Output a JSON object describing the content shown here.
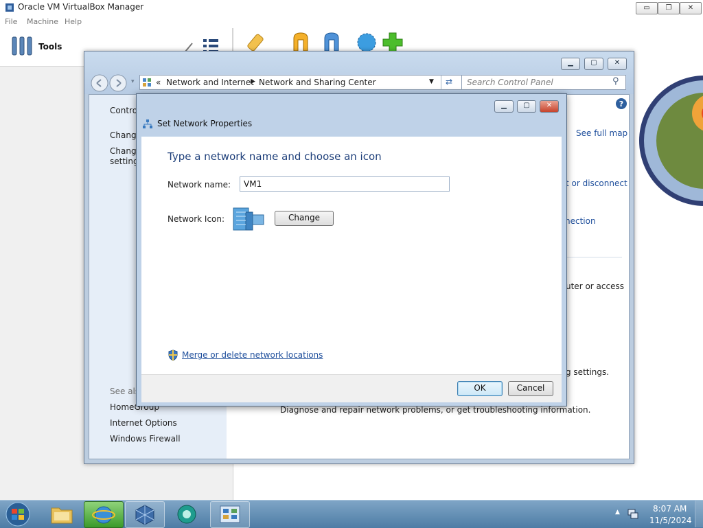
{
  "vbox": {
    "title": "Oracle VM VirtualBox Manager",
    "menu": [
      "File",
      "Machine",
      "Help"
    ],
    "tools_label": "Tools",
    "controls": [
      "▭",
      "❐",
      "✕"
    ]
  },
  "control_panel": {
    "breadcrumb": {
      "prefix": "«",
      "items": [
        "Network and Internet",
        "Network and Sharing Center"
      ]
    },
    "search_placeholder": "Search Control Panel",
    "left_items": [
      "Control",
      "Change",
      "Change",
      "settings"
    ],
    "see_also_label": "See also",
    "see_also_items": [
      "HomeGroup",
      "Internet Options",
      "Windows Firewall"
    ],
    "right_fragments": {
      "see_full_map": "See full map",
      "connect_disconnect": "t or disconnect",
      "nection": "nection",
      "uter_or_access": "uter or access",
      "g_settings": "g settings.",
      "troubleshoot": "Diagnose and repair network problems, or get troubleshooting information."
    }
  },
  "dialog": {
    "title": "Set Network Properties",
    "heading": "Type a network name and choose an icon",
    "network_name_label": "Network name:",
    "network_name_value": "VM1",
    "network_icon_label": "Network Icon:",
    "change_button": "Change",
    "merge_link": "Merge or delete network locations",
    "ok_button": "OK",
    "cancel_button": "Cancel"
  },
  "taskbar": {
    "time": "8:07 AM",
    "date": "11/5/2024"
  }
}
